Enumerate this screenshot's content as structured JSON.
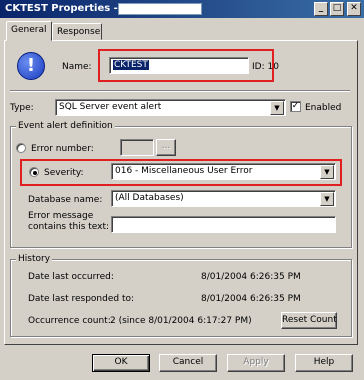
{
  "window": {
    "title": "CKTEST Properties -",
    "minimize_glyph": "_",
    "maximize_glyph": "□",
    "close_glyph": "✕"
  },
  "tabs": [
    {
      "label": "General",
      "active": true
    },
    {
      "label": "Response",
      "active": false
    }
  ],
  "general": {
    "icon": "alert-exclamation-icon",
    "name_label": "Name:",
    "name_value": "CKTEST",
    "id_label": "ID: 10",
    "type_label": "Type:",
    "type_value": "SQL Server event alert",
    "enabled_label": "Enabled",
    "enabled_checked": true
  },
  "event_definition": {
    "legend": "Event alert definition",
    "error_number_label": "Error number:",
    "error_number_value": "",
    "browse_label": "...",
    "severity_label": "Severity:",
    "severity_value": "016 - Miscellaneous User Error",
    "selected_option": "Severity",
    "database_label": "Database name:",
    "database_value": "(All Databases)",
    "error_message_label_line1": "Error message",
    "error_message_label_line2": "contains this text:",
    "error_message_value": ""
  },
  "history": {
    "legend": "History",
    "last_occurred_label": "Date last occurred:",
    "last_occurred_value": "8/01/2004 6:26:35 PM",
    "last_responded_label": "Date last responded to:",
    "last_responded_value": "8/01/2004 6:26:35 PM",
    "occurrence_label": "Occurrence count:",
    "occurrence_value": "2 (since 8/01/2004 6:17:27 PM)",
    "reset_label": "Reset Count"
  },
  "footer": {
    "ok_label": "OK",
    "cancel_label": "Cancel",
    "apply_label": "Apply",
    "help_label": "Help"
  }
}
